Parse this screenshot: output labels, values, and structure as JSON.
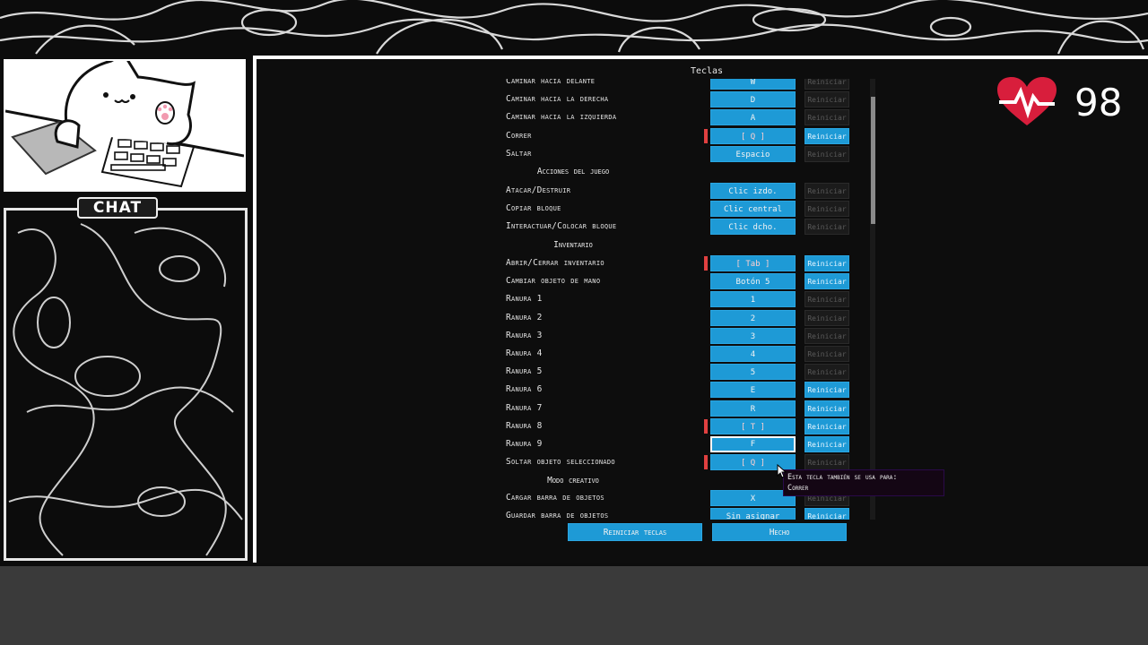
{
  "overlay": {
    "chat_label": "CHAT",
    "health_value": "98"
  },
  "screen": {
    "title": "Teclas",
    "footer": {
      "reset_all": "Reiniciar teclas",
      "done": "Hecho"
    },
    "tooltip": {
      "line1": "Esta tecla también se usa para:",
      "line2": "Correr"
    }
  },
  "keybinds": {
    "movement": [
      {
        "label": "Caminar hacia delante",
        "key": "W",
        "reset": "Reiniciar",
        "reset_active": false,
        "conflict": false
      },
      {
        "label": "Caminar hacia la derecha",
        "key": "D",
        "reset": "Reiniciar",
        "reset_active": false,
        "conflict": false
      },
      {
        "label": "Caminar hacia la izquierda",
        "key": "A",
        "reset": "Reiniciar",
        "reset_active": false,
        "conflict": false
      },
      {
        "label": "Correr",
        "key": "[ Q ]",
        "reset": "Reiniciar",
        "reset_active": true,
        "conflict": true
      },
      {
        "label": "Saltar",
        "key": "Espacio",
        "reset": "Reiniciar",
        "reset_active": false,
        "conflict": false
      }
    ],
    "game_actions_title": "Acciones del juego",
    "game_actions": [
      {
        "label": "Atacar/Destruir",
        "key": "Clic izdo.",
        "reset": "Reiniciar",
        "reset_active": false,
        "conflict": false
      },
      {
        "label": "Copiar bloque",
        "key": "Clic central",
        "reset": "Reiniciar",
        "reset_active": false,
        "conflict": false
      },
      {
        "label": "Interactuar/Colocar bloque",
        "key": "Clic dcho.",
        "reset": "Reiniciar",
        "reset_active": false,
        "conflict": false
      }
    ],
    "inventory_title": "Inventario",
    "inventory": [
      {
        "label": "Abrir/Cerrar inventario",
        "key": "[ Tab ]",
        "reset": "Reiniciar",
        "reset_active": true,
        "conflict": true
      },
      {
        "label": "Cambiar objeto de mano",
        "key": "Botón 5",
        "reset": "Reiniciar",
        "reset_active": true,
        "conflict": false
      },
      {
        "label": "Ranura 1",
        "key": "1",
        "reset": "Reiniciar",
        "reset_active": false,
        "conflict": false
      },
      {
        "label": "Ranura 2",
        "key": "2",
        "reset": "Reiniciar",
        "reset_active": false,
        "conflict": false
      },
      {
        "label": "Ranura 3",
        "key": "3",
        "reset": "Reiniciar",
        "reset_active": false,
        "conflict": false
      },
      {
        "label": "Ranura 4",
        "key": "4",
        "reset": "Reiniciar",
        "reset_active": false,
        "conflict": false
      },
      {
        "label": "Ranura 5",
        "key": "5",
        "reset": "Reiniciar",
        "reset_active": false,
        "conflict": false
      },
      {
        "label": "Ranura 6",
        "key": "E",
        "reset": "Reiniciar",
        "reset_active": true,
        "conflict": false
      },
      {
        "label": "Ranura 7",
        "key": "R",
        "reset": "Reiniciar",
        "reset_active": true,
        "conflict": false
      },
      {
        "label": "Ranura 8",
        "key": "[ T ]",
        "reset": "Reiniciar",
        "reset_active": true,
        "conflict": true
      },
      {
        "label": "Ranura 9",
        "key": "F",
        "reset": "Reiniciar",
        "reset_active": true,
        "conflict": false,
        "selected": true
      },
      {
        "label": "Soltar objeto seleccionado",
        "key": "[ Q ]",
        "reset": "Reiniciar",
        "reset_active": false,
        "conflict": true
      }
    ],
    "creative_title": "Modo creativo",
    "creative": [
      {
        "label": "Cargar barra de objetos",
        "key": "X",
        "reset": "Reiniciar",
        "reset_active": false,
        "conflict": false
      },
      {
        "label": "Guardar barra de objetos",
        "key": "Sin asignar",
        "reset": "Reiniciar",
        "reset_active": true,
        "conflict": false
      }
    ]
  },
  "colors": {
    "button_blue": "#1e9ad6",
    "conflict_red": "#e04040",
    "heart_red": "#d81e3c"
  }
}
